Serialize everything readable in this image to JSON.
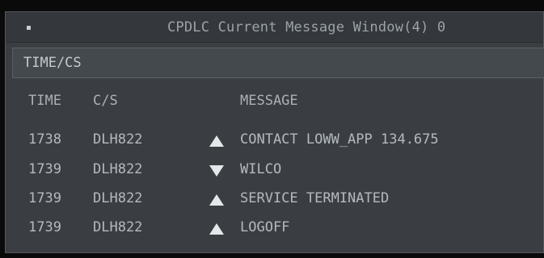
{
  "window": {
    "title": "CPDLC Current Message Window(4) 0"
  },
  "filter": {
    "label": "TIME/CS"
  },
  "columns": {
    "time": "TIME",
    "cs": "C/S",
    "message": "MESSAGE"
  },
  "messages": [
    {
      "time": "1738",
      "cs": "DLH822",
      "direction": "up",
      "text": "CONTACT LOWW_APP 134.675"
    },
    {
      "time": "1739",
      "cs": "DLH822",
      "direction": "down",
      "text": "WILCO"
    },
    {
      "time": "1739",
      "cs": "DLH822",
      "direction": "up",
      "text": "SERVICE TERMINATED"
    },
    {
      "time": "1739",
      "cs": "DLH822",
      "direction": "up",
      "text": "LOGOFF"
    }
  ],
  "icons": {
    "up": "triangle-up-icon",
    "down": "triangle-down-icon",
    "system_menu": "system-menu-icon"
  },
  "colors": {
    "text": "#b3bac0",
    "arrow": "#e4e8eb",
    "window_bg": "#3a3e42"
  }
}
